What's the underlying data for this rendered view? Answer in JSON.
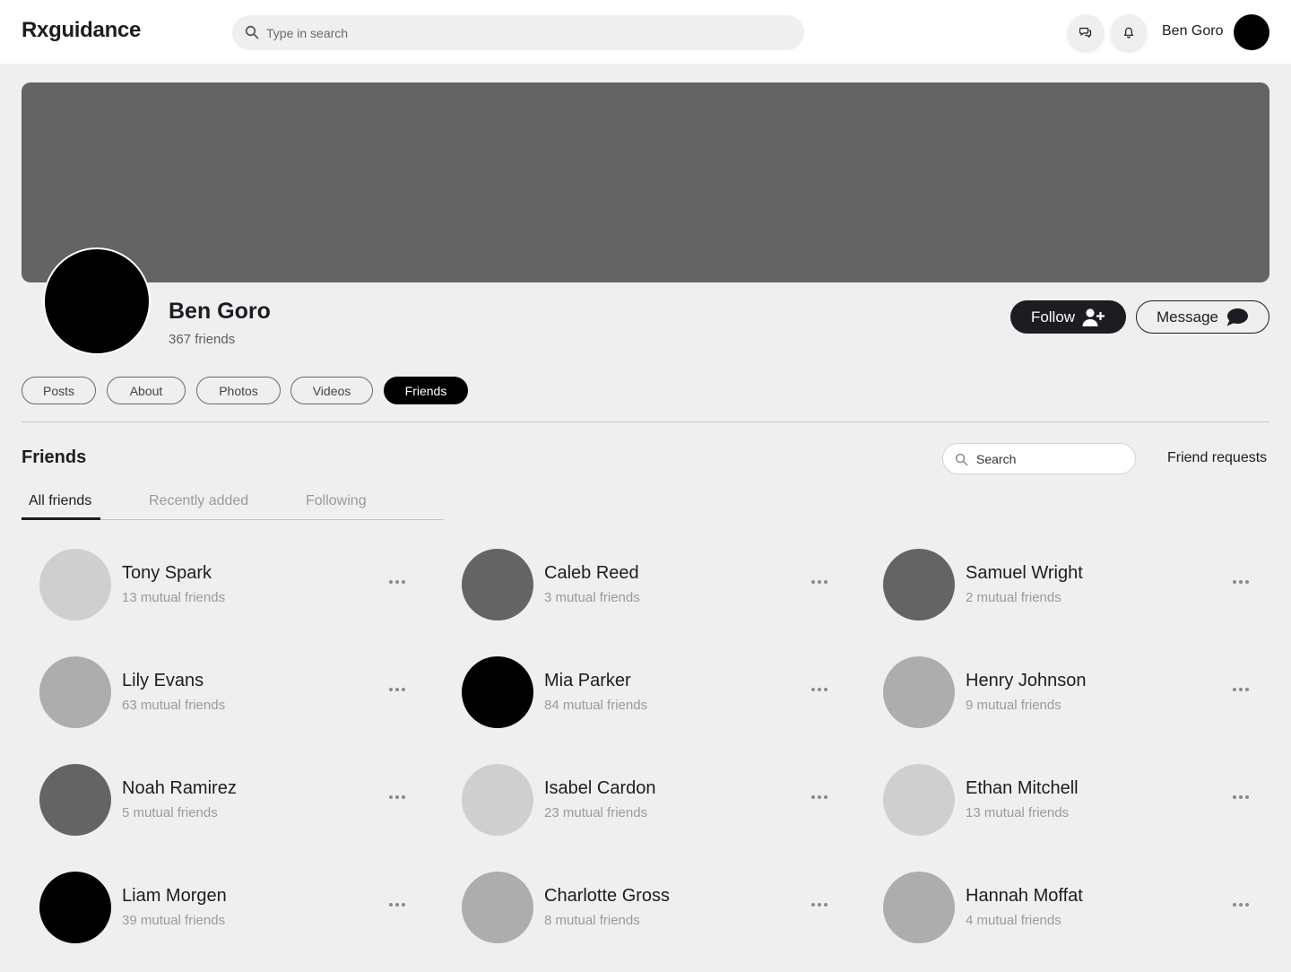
{
  "header": {
    "brand": "Rxguidance",
    "search_placeholder": "Type in search",
    "user_name": "Ben Goro"
  },
  "profile": {
    "name": "Ben Goro",
    "friends_count": "367 friends",
    "follow_label": "Follow",
    "message_label": "Message"
  },
  "tabs": [
    "Posts",
    "About",
    "Photos",
    "Videos",
    "Friends"
  ],
  "active_tab": "Friends",
  "friends_section": {
    "title": "Friends",
    "search_placeholder": "Search",
    "requests_label": "Friend requests",
    "subtabs": [
      "All friends",
      "Recently added",
      "Following"
    ],
    "active_subtab": "All friends",
    "friends": [
      {
        "name": "Tony Spark",
        "mutual": "13 mutual friends",
        "avatar_color": "#cfcfcf"
      },
      {
        "name": "Caleb Reed",
        "mutual": "3 mutual friends",
        "avatar_color": "#646464"
      },
      {
        "name": "Samuel Wright",
        "mutual": "2 mutual friends",
        "avatar_color": "#646464"
      },
      {
        "name": "Lily Evans",
        "mutual": "63 mutual friends",
        "avatar_color": "#adadad"
      },
      {
        "name": "Mia Parker",
        "mutual": "84 mutual friends",
        "avatar_color": "#000000"
      },
      {
        "name": "Henry Johnson",
        "mutual": "9 mutual friends",
        "avatar_color": "#adadad"
      },
      {
        "name": "Noah Ramirez",
        "mutual": "5 mutual friends",
        "avatar_color": "#646464"
      },
      {
        "name": "Isabel Cardon",
        "mutual": "23 mutual friends",
        "avatar_color": "#cfcfcf"
      },
      {
        "name": "Ethan Mitchell",
        "mutual": "13 mutual friends",
        "avatar_color": "#cfcfcf"
      },
      {
        "name": "Liam Morgen",
        "mutual": "39 mutual friends",
        "avatar_color": "#000000"
      },
      {
        "name": "Charlotte Gross",
        "mutual": "8 mutual friends",
        "avatar_color": "#adadad"
      },
      {
        "name": "Hannah Moffat",
        "mutual": "4 mutual friends",
        "avatar_color": "#adadad"
      }
    ]
  },
  "colors": {
    "primary": "#1c1c22",
    "background": "#efefef",
    "cover": "#646464"
  }
}
